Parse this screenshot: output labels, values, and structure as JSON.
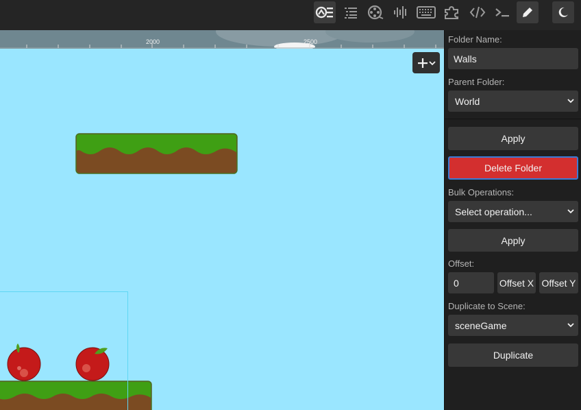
{
  "toolbar": {
    "buttons": [
      {
        "name": "scene-outline-icon"
      },
      {
        "name": "list-icon"
      },
      {
        "name": "film-reel-icon"
      },
      {
        "name": "audio-waveform-icon"
      },
      {
        "name": "keyboard-icon"
      },
      {
        "name": "puzzle-icon"
      },
      {
        "name": "code-icon"
      },
      {
        "name": "terminal-icon"
      },
      {
        "name": "pencil-icon"
      },
      {
        "name": "moon-icon"
      }
    ]
  },
  "ruler": {
    "labels": [
      "2000",
      "2500"
    ]
  },
  "panel": {
    "folder_name_label": "Folder Name:",
    "folder_name_value": "Walls",
    "parent_folder_label": "Parent Folder:",
    "parent_folder_value": "World",
    "apply_label": "Apply",
    "delete_label": "Delete Folder",
    "bulk_label": "Bulk Operations:",
    "bulk_value": "Select operation...",
    "bulk_apply_label": "Apply",
    "offset_label": "Offset:",
    "offset_value": "0",
    "offset_x_label": "Offset X",
    "offset_y_label": "Offset Y",
    "duplicate_label": "Duplicate to Scene:",
    "duplicate_scene_value": "sceneGame",
    "duplicate_button_label": "Duplicate"
  },
  "colors": {
    "sky": "#9ae6ff",
    "grass": "#3f9f14",
    "dirt": "#7b4b22",
    "apple": "#d0201e",
    "danger": "#d32f2f",
    "panel_bg": "#1f1f1f"
  }
}
